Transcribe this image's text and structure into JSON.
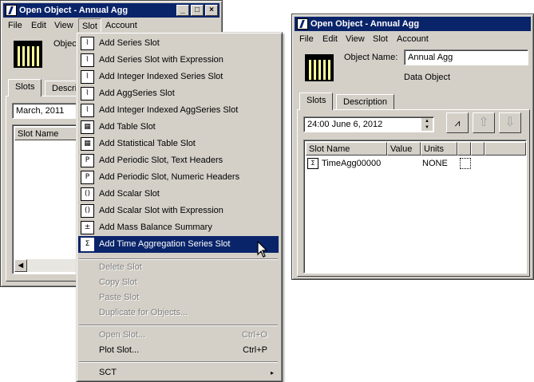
{
  "left_window": {
    "title": "Open Object - Annual Agg",
    "menubar": [
      "File",
      "Edit",
      "View",
      "Slot",
      "Account"
    ],
    "object_label": "Object",
    "tabs": [
      "Slots",
      "Descrip"
    ],
    "date_value": "March, 2011",
    "column_header": "Slot Name"
  },
  "right_window": {
    "title": "Open Object - Annual Agg",
    "menubar": [
      "File",
      "Edit",
      "View",
      "Slot",
      "Account"
    ],
    "object_name_label": "Object Name:",
    "object_name_value": "Annual Agg",
    "object_type": "Data Object",
    "tabs": [
      "Slots",
      "Description"
    ],
    "datetime_value": "24:00 June 6, 2012",
    "columns": [
      "Slot Name",
      "Value",
      "Units"
    ],
    "rows": [
      {
        "name": "TimeAgg00000",
        "value": "",
        "units": "NONE"
      }
    ]
  },
  "slot_menu": {
    "items": [
      {
        "label": "Add Series Slot",
        "icon": "series-slot-icon",
        "glyph": "⌇"
      },
      {
        "label": "Add Series Slot with Expression",
        "icon": "series-expression-icon",
        "glyph": "⌇"
      },
      {
        "label": "Add Integer Indexed Series Slot",
        "icon": "integer-series-icon",
        "glyph": "⌇"
      },
      {
        "label": "Add AggSeries Slot",
        "icon": "aggseries-slot-icon",
        "glyph": "⌇"
      },
      {
        "label": "Add Integer Indexed AggSeries Slot",
        "icon": "integer-aggseries-icon",
        "glyph": "⌇"
      },
      {
        "label": "Add Table Slot",
        "icon": "table-slot-icon",
        "glyph": "▦"
      },
      {
        "label": "Add Statistical Table Slot",
        "icon": "statistical-table-icon",
        "glyph": "▦"
      },
      {
        "label": "Add Periodic Slot, Text Headers",
        "icon": "periodic-text-icon",
        "glyph": "P"
      },
      {
        "label": "Add Periodic Slot, Numeric Headers",
        "icon": "periodic-numeric-icon",
        "glyph": "P"
      },
      {
        "label": "Add Scalar Slot",
        "icon": "scalar-slot-icon",
        "glyph": "()"
      },
      {
        "label": "Add Scalar Slot with Expression",
        "icon": "scalar-expression-icon",
        "glyph": "()"
      },
      {
        "label": "Add Mass Balance Summary",
        "icon": "mass-balance-icon",
        "glyph": "±"
      },
      {
        "label": "Add Time Aggregation Series Slot",
        "icon": "time-aggregation-icon",
        "glyph": "Σ"
      }
    ],
    "disabled_items": [
      "Delete Slot",
      "Copy Slot",
      "Paste Slot",
      "Duplicate for Objects..."
    ],
    "open_slot": {
      "label": "Open Slot...",
      "shortcut": "Ctrl+O"
    },
    "plot_slot": {
      "label": "Plot Slot...",
      "shortcut": "Ctrl+P"
    },
    "sct": {
      "label": "SCT",
      "arrow": "▸"
    }
  }
}
